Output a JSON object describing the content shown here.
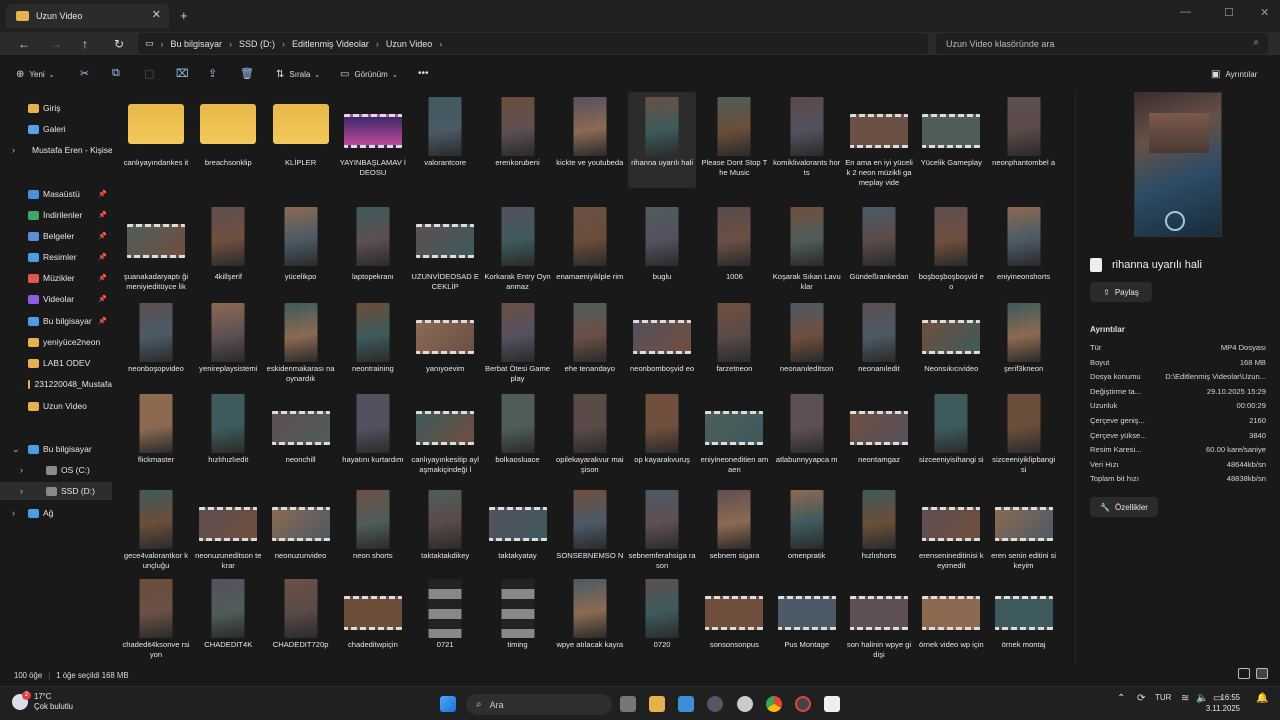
{
  "window": {
    "tab_title": "Uzun Video",
    "close_tab": "✕",
    "new_tab": "+",
    "minimize": "—",
    "maximize": "☐",
    "close": "✕"
  },
  "address": {
    "crumbs": [
      "Bu bilgisayar",
      "SSD (D:)",
      "Editlenmiş Videolar",
      "Uzun Video"
    ],
    "search_placeholder": "Uzun Video klasöründe ara"
  },
  "commands": {
    "new": "Yeni",
    "sort": "Sırala",
    "view": "Görünüm",
    "more": "•••",
    "details_pane": "Ayrıntılar"
  },
  "sidebar": {
    "items": [
      {
        "label": "Giriş",
        "color": "#e7b24e"
      },
      {
        "label": "Galeri",
        "color": "#5aa0e8"
      },
      {
        "label": "Mustafa Eren - Kişisel",
        "color": "#4aa0e0"
      },
      {
        "label": "Masaüstü",
        "color": "#4a8fe0"
      },
      {
        "label": "İndirilenler",
        "color": "#3ea86a"
      },
      {
        "label": "Belgeler",
        "color": "#5d8fd6"
      },
      {
        "label": "Resimler",
        "color": "#4a9ee6"
      },
      {
        "label": "Müzikler",
        "color": "#e0574e"
      },
      {
        "label": "Videolar",
        "color": "#8f5de0"
      },
      {
        "label": "Bu bilgisayar",
        "color": "#4a9ee6"
      },
      {
        "label": "yeniyüce2neon",
        "color": "#e7b24e"
      },
      {
        "label": "LAB1 ODEV",
        "color": "#e7b24e"
      },
      {
        "label": "231220048_Mustafa",
        "color": "#e7b24e"
      },
      {
        "label": "Uzun Video",
        "color": "#e7b24e"
      },
      {
        "label": "Bu bilgisayar",
        "color": "#4a9ee6"
      },
      {
        "label": "OS (C:)",
        "color": "#8a8a8a"
      },
      {
        "label": "SSD (D:)",
        "color": "#8a8a8a"
      },
      {
        "label": "Ağ",
        "color": "#4a9ee6"
      }
    ]
  },
  "files": [
    [
      "canlıyayındankes it",
      "breachsonklip",
      "KLİPLER",
      "YAYINBAŞLAMAV İDEOSU",
      "valorantcore",
      "erenkorubeni",
      "kickte ve youtubeda",
      "rihanna uyarılı hali",
      "Please Dont Stop The Music",
      "komiklivalorants horts",
      "En ama en iyi yücelik 2 neon müzikli gameplay vide",
      "Yücelik Gameplay",
      "neonphantombel a"
    ],
    [
      "şuanakadaryaptı ğimeniyieditüyce lik",
      "4killşerif",
      "yücelikpo",
      "laptopekranı",
      "UZUNVİDEOSAD ECEKLİP",
      "Korkarak Entry Oynanmaz",
      "enamaeniyiklple rim",
      "buglu",
      "1006",
      "Koşarak Sıkan Lavuklar",
      "Gündeßrankedan",
      "boşboşboşboşvid eo",
      "eniyineonshorts"
    ],
    [
      "neonboşopvideo",
      "yenireplaysistemi",
      "eskidenmakarası naoynardık",
      "neontraining",
      "yanıyoevim",
      "Berbat Ötesi Gameplay",
      "ehe tenandayo",
      "neonbomboşvid eo",
      "farzetneon",
      "neonanıleditson",
      "neonanıledit",
      "Neonsıkıcıvideo",
      "şerif3kneon"
    ],
    [
      "flickmaster",
      "hızlıhızlıedit",
      "neonchill",
      "hayatını kurtardım",
      "canlıyayınkesitip aylaşmakiçindeği l",
      "bolkaosluace",
      "opilekayarakvur maişison",
      "op kayarakvuruş",
      "eniyineoneditien amaen",
      "atlabunnyyapca m",
      "neontamgaz",
      "sizceeniyisihangi si",
      "sizceeniyiklipbangi si"
    ],
    [
      "gece4valorantkor kunçluğu",
      "neonuzuneditson tekrar",
      "neonuzunvideo",
      "neon shorts",
      "taktaktakdikey",
      "taktakyatay",
      "SONSEBNEMSO N",
      "sebnemferahsiga rason",
      "sebnem sigara",
      "omenpratik",
      "hızlıshorts",
      "erensenineditinisi keyimedit",
      "eren senin editini sikeyim"
    ],
    [
      "chadedit4ksonve rsiyon",
      "CHADEDIT4K",
      "CHADEDIT720p",
      "chadeditwpiçin",
      "0721",
      "timing",
      "wpye atılacak kayra",
      "0720",
      "sonsonsonpus",
      "Pus Montage",
      "son halinin wpye gidişi",
      "örnek video wp için",
      "örnek montaj"
    ]
  ],
  "details": {
    "title": "rihanna uyarılı hali",
    "share": "Paylaş",
    "section": "Ayrıntılar",
    "rows": [
      {
        "k": "Tür",
        "v": "MP4 Dosyası"
      },
      {
        "k": "Boyut",
        "v": "168 MB"
      },
      {
        "k": "Dosya konumu",
        "v": "D:\\Editlenmiş Videolar\\Uzun..."
      },
      {
        "k": "Değiştirme ta...",
        "v": "29.10.2025 15:29"
      },
      {
        "k": "Uzunluk",
        "v": "00:00:29"
      },
      {
        "k": "Çerçeve geniş...",
        "v": "2160"
      },
      {
        "k": "Çerçeve yükse...",
        "v": "3840"
      },
      {
        "k": "Resim Karesi...",
        "v": "60.00 kare/saniye"
      },
      {
        "k": "Veri Hızı",
        "v": "48644kb/sn"
      },
      {
        "k": "Toplam bit hızı",
        "v": "48838kb/sn"
      }
    ],
    "properties": "Özellikler"
  },
  "status": {
    "count": "100 öğe",
    "selected": "1 öğe seçildi  168 MB"
  },
  "taskbar": {
    "temp": "17°C",
    "weather": "Çok bulutlu",
    "badge": "2",
    "search": "Ara",
    "time": "16:55",
    "date": "3.11.2025",
    "lang": "TUR"
  }
}
